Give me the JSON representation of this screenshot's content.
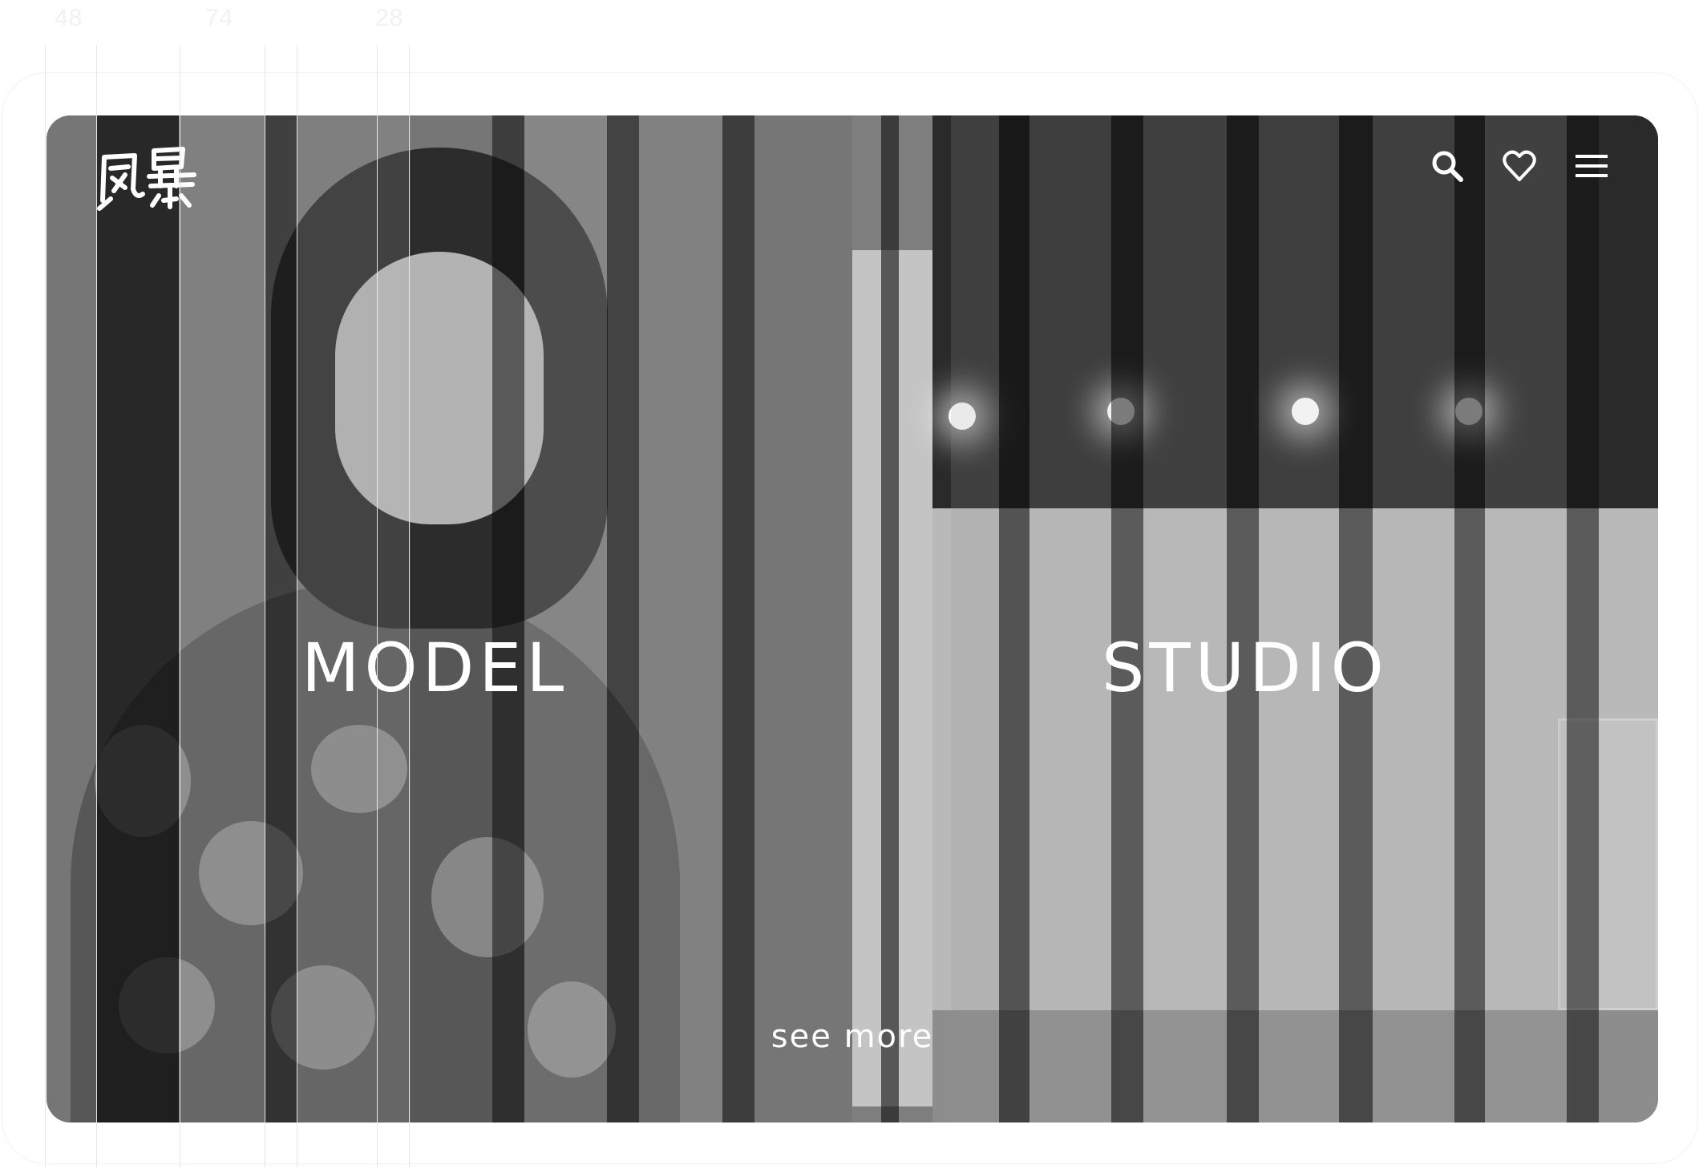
{
  "spec_labels": [
    "48",
    "74",
    "28"
  ],
  "brand": {
    "logo_name": "brand-logo",
    "logo_glyphs": "風暴"
  },
  "header": {
    "icons": [
      "search-icon",
      "heart-icon",
      "hamburger-menu-icon"
    ]
  },
  "hero": {
    "left_title": "MODEL",
    "right_title": "STUDIO",
    "cta": "see more"
  },
  "colors": {
    "text": "#ffffff",
    "background": "#ffffff",
    "overlay_dark": "#111111",
    "overlay_light": "#a0a0a0"
  }
}
